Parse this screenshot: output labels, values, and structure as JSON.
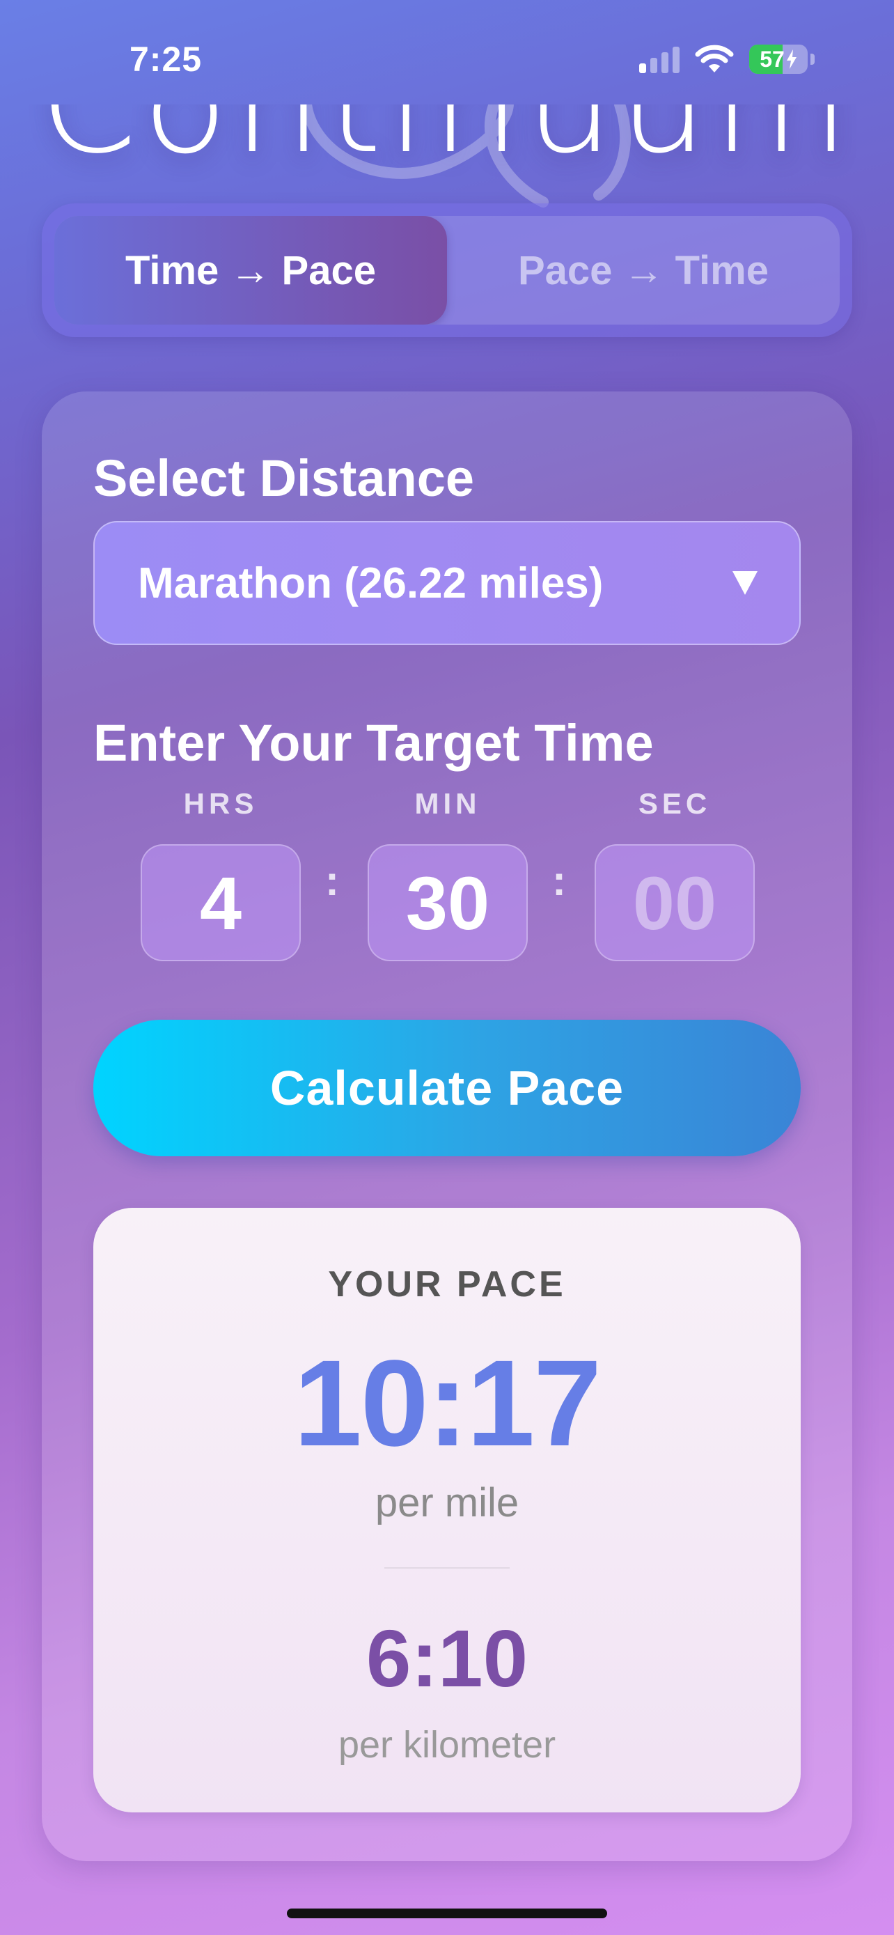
{
  "status_bar": {
    "time": "7:25",
    "battery_percent": 57,
    "battery_label": "57",
    "charging": true,
    "signal_bars_active": 1,
    "icons": [
      "cellular-signal-icon",
      "wifi-icon",
      "battery-charging-icon"
    ]
  },
  "logo": {
    "text": "Continuum",
    "icon": "infinity-swirl-icon"
  },
  "mode_toggle": {
    "tabs": [
      {
        "label": "Time → Pace",
        "active": true
      },
      {
        "label": "Pace → Time",
        "active": false
      }
    ]
  },
  "distance": {
    "title": "Select Distance",
    "selected": "Marathon (26.22 miles)",
    "icon": "chevron-down-icon"
  },
  "target_time": {
    "title": "Enter Your Target Time",
    "fields": [
      {
        "unit": "HRS",
        "value": "4",
        "placeholder": ""
      },
      {
        "unit": "MIN",
        "value": "30",
        "placeholder": ""
      },
      {
        "unit": "SEC",
        "value": "",
        "placeholder": "00"
      }
    ],
    "separator": ":"
  },
  "calculate_button": {
    "label": "Calculate Pace"
  },
  "result": {
    "label": "YOUR PACE",
    "per_mile_value": "10:17",
    "per_mile_unit": "per mile",
    "per_km_value": "6:10",
    "per_km_unit": "per kilometer"
  },
  "colors": {
    "accent_cyan": "#00d4ff",
    "accent_blue": "#667ee6",
    "accent_purple": "#7b4fa6",
    "battery_green": "#34c759"
  }
}
